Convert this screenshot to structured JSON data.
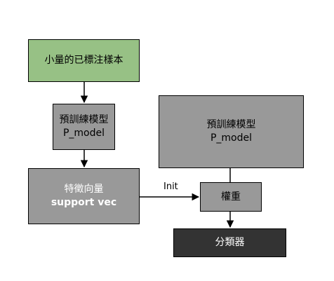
{
  "diagram": {
    "labeled_samples": {
      "label": "小量的已標注樣本"
    },
    "pretrained_left": {
      "line1": "預訓練模型",
      "line2": "P_model"
    },
    "support_vec": {
      "line1": "特徵向量",
      "line2": "support vec"
    },
    "pretrained_right": {
      "line1": "預訓練模型",
      "line2": "P_model"
    },
    "weights": {
      "label": "權重"
    },
    "classifier": {
      "label": "分類器"
    },
    "init_edge": {
      "label": "Init"
    }
  },
  "colors": {
    "labeled_fill": "#97c185",
    "model_fill": "#999999",
    "classifier_fill": "#333333",
    "edge": "#000000"
  }
}
